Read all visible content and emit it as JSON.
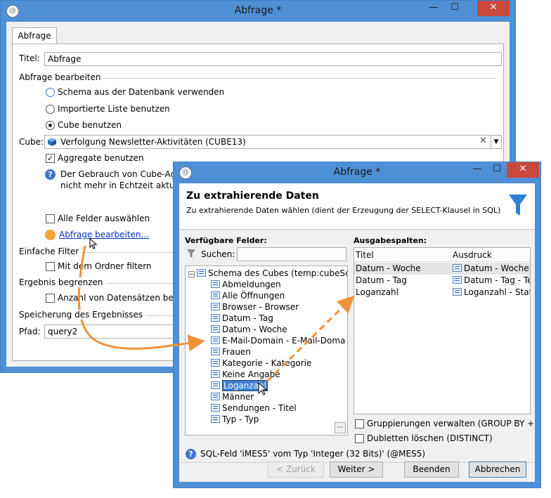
{
  "main_window": {
    "title": "Abfrage *",
    "controls": {
      "minimize": "—",
      "maximize": "☐",
      "close": "✕"
    },
    "tab_label": "Abfrage",
    "title_label": "Titel:",
    "title_value": "Abfrage",
    "section_edit": "Abfrage bearbeiten",
    "radio_options": [
      {
        "label": "Schema aus der Datenbank verwenden",
        "selected": false
      },
      {
        "label": "Importierte Liste benutzen",
        "selected": false
      },
      {
        "label": "Cube benutzen",
        "selected": true
      }
    ],
    "cube_label": "Cube:",
    "cube_value": "Verfolgung Newsletter-Aktivitäten (CUBE13)",
    "aggregate_label": "Aggregate benutzen",
    "aggregate_checked": true,
    "info_line1": "Der Gebrauch von Cube-Aggre",
    "info_line2": "nicht mehr in Echtzeit aktualisi",
    "select_all_label": "Alle Felder auswählen",
    "edit_query_link": "Abfrage bearbeiten...",
    "section_filter": "Einfache Filter",
    "folder_filter_label": "Mit dem Ordner filtern",
    "section_limit": "Ergebnis begrenzen",
    "limit_label": "Anzahl von Datensätzen begrenz",
    "section_save": "Speicherung des Ergebnisses",
    "path_label": "Pfad:",
    "path_value": "query2"
  },
  "dialog": {
    "title": "Abfrage *",
    "controls": {
      "minimize": "—",
      "maximize": "☐",
      "close": "✕"
    },
    "header_title": "Zu extrahierende Daten",
    "header_subtitle": "Zu extrahierende Daten wählen (dient der Erzeugung der SELECT-Klausel in SQL)",
    "available_fields_label": "Verfügbare Felder:",
    "search_label": "Suchen:",
    "search_value": "",
    "tree_root": "Schema des Cubes (temp:cubeSch",
    "tree_items": [
      "Abmeldungen",
      "Alle Öffnungen",
      "Browser - Browser",
      "Datum - Tag",
      "Datum - Woche",
      "E-Mail-Domain - E-Mail-Doma",
      "Frauen",
      "Kategorie - Kategorie",
      "Keine Angabe",
      "Loganzahl",
      "Männer",
      "Sendungen  - Titel",
      "Typ - Typ"
    ],
    "selected_item_index": 9,
    "output_columns_label": "Ausgabespalten:",
    "columns_headers": {
      "title": "Titel",
      "expression": "Ausdruck"
    },
    "columns_rows": [
      {
        "title": "Datum - Woche",
        "expression": "Datum - Woche - W"
      },
      {
        "title": "Datum - Tag",
        "expression": "Datum - Tag - Tex"
      },
      {
        "title": "Loganzahl",
        "expression": "Loganzahl - Status"
      }
    ],
    "group_by_label": "Gruppierungen verwalten (GROUP BY + HAV",
    "distinct_label": "Dubletten löschen (DISTINCT)",
    "sql_info": "SQL-Feld 'iMES5' vom Typ 'Integer (32 Bits)' (@MES5)",
    "btn_back": "< Zurück",
    "btn_next": "Weiter >",
    "btn_finish": "Beenden",
    "btn_cancel": "Abbrechen"
  },
  "colors": {
    "window_frame": "#4f8fd6",
    "selection": "#3e7fd4",
    "arrow": "#f0913a",
    "funnel": "#2f7fd4",
    "close_button": "#c9483c"
  }
}
